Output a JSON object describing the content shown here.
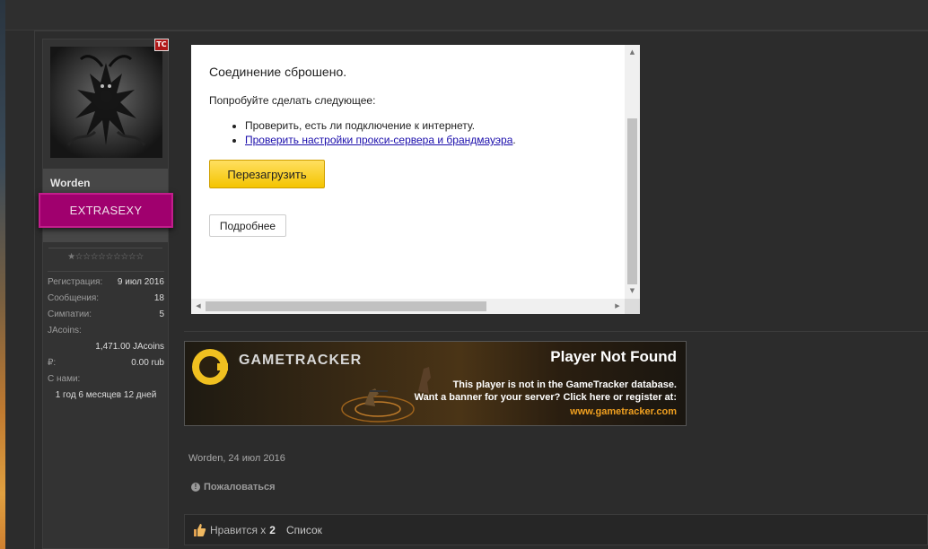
{
  "user": {
    "name": "Worden",
    "badge": "TC",
    "title": "EXTRASEXY",
    "rating_stars": "★☆☆☆☆☆☆☆☆☆",
    "stats": {
      "registration_label": "Регистрация:",
      "registration_value": "9 июл 2016",
      "messages_label": "Сообщения:",
      "messages_value": "18",
      "likes_label": "Симпатии:",
      "likes_value": "5",
      "jacoins_label": "JAcoins:",
      "jacoins_value": "1,471.00 JAcoins",
      "rub_label": "₽:",
      "rub_value": "0.00 rub",
      "with_us_label": "С нами:",
      "with_us_value": "1 год 6 месяцев 12 дней"
    }
  },
  "error_page": {
    "title": "Соединение сброшено.",
    "subtitle": "Попробуйте сделать следующее:",
    "item1": "Проверить, есть ли подключение к интернету.",
    "item2_link": "Проверить настройки прокси-сервера и брандмауэра",
    "item2_suffix": ".",
    "reload_button": "Перезагрузить",
    "details_button": "Подробнее"
  },
  "banner": {
    "brand": "GAMETRACKER",
    "status": "Player Not Found",
    "line1": "This player is not in the GameTracker database.",
    "line2": "Want a banner for your server?  Click here or register at:",
    "url": "www.gametracker.com",
    "accent_color": "#f0a020"
  },
  "post": {
    "meta": "Worden, 24 июл 2016",
    "report": "Пожаловаться",
    "likes_prefix": "Нравится x",
    "likes_count": "2",
    "likes_list": "Список"
  }
}
